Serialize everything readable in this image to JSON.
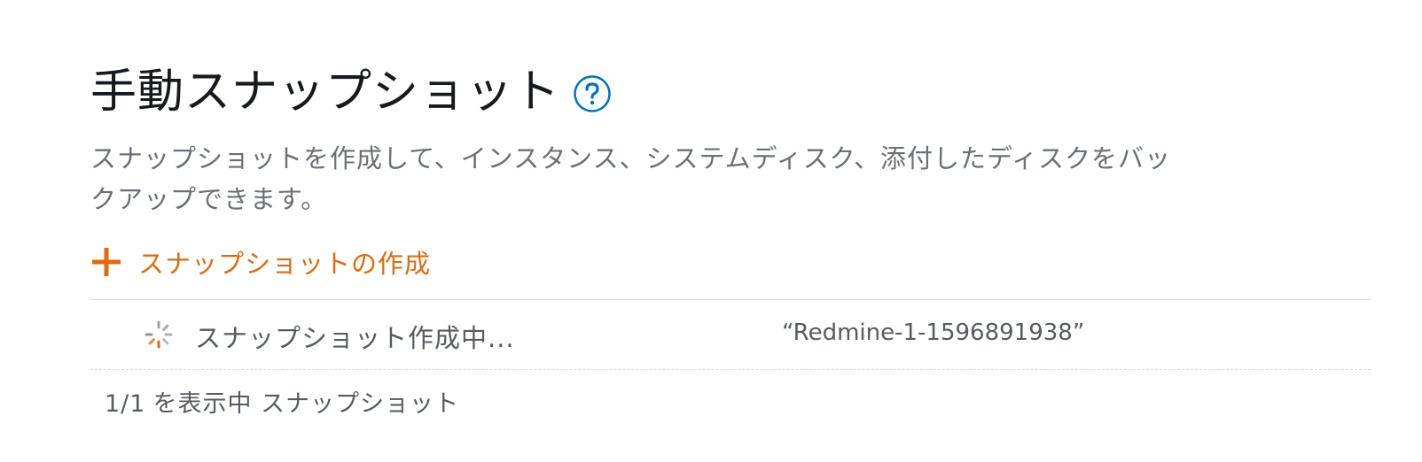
{
  "section": {
    "title": "手動スナップショット",
    "help_icon": "question-circle-icon",
    "description": "スナップショットを作成して、インスタンス、システムディスク、添付したディスクをバックアップできます。"
  },
  "create": {
    "icon": "plus-icon",
    "label": "スナップショットの作成"
  },
  "snapshots": [
    {
      "status_icon": "spinner-icon",
      "status": "スナップショット作成中...",
      "name": "“Redmine-1-1596891938”"
    }
  ],
  "footer": {
    "count": "1/1",
    "label": "を表示中 スナップショット"
  },
  "colors": {
    "accent": "#dd6b10",
    "help": "#0073bb",
    "text_primary": "#16191f",
    "text_secondary": "#687078"
  }
}
